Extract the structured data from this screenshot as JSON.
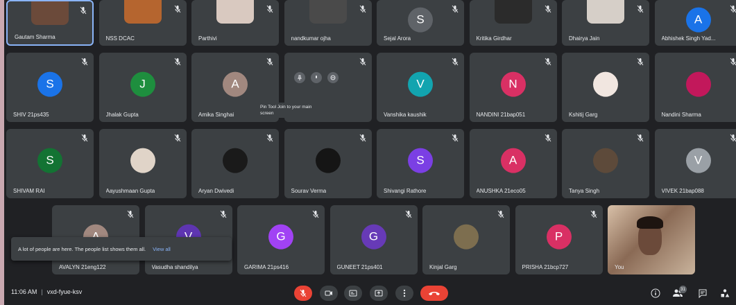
{
  "colors": {
    "tile_bg": "#3c4043",
    "page_bg": "#202124",
    "danger": "#ea4335",
    "link": "#8ab4f8"
  },
  "rows": [
    [
      {
        "name": "Gautam Sharma",
        "kind": "photo",
        "color": "#6b4a3a",
        "highlight": true
      },
      {
        "name": "NSS DCAC",
        "kind": "photo",
        "color": "#b5652f"
      },
      {
        "name": "Parthivi",
        "kind": "photo",
        "color": "#d9c9c0"
      },
      {
        "name": "nandkumar ojha",
        "kind": "photo",
        "color": "#4a4a4a"
      },
      {
        "name": "Sejal Arora",
        "kind": "letter",
        "letter": "S",
        "color": "#5f6368"
      },
      {
        "name": "Kritika Girdhar",
        "kind": "photo",
        "color": "#2b2b2b"
      },
      {
        "name": "Dhairya Jain",
        "kind": "photo",
        "color": "#d6cfc8"
      },
      {
        "name": "Abhishek Singh Yad...",
        "kind": "letter",
        "letter": "A",
        "color": "#1a73e8"
      }
    ],
    [
      {
        "name": "SHIV 21ps435",
        "kind": "letter",
        "letter": "S",
        "color": "#1a73e8"
      },
      {
        "name": "Jhalak Gupta",
        "kind": "letter",
        "letter": "J",
        "color": "#1e8e3e"
      },
      {
        "name": "Amika Singhai",
        "kind": "letter",
        "letter": "A",
        "color": "#a1887f"
      },
      {
        "name": "",
        "kind": "pinned"
      },
      {
        "name": "Vanshika kaushik",
        "kind": "letter",
        "letter": "V",
        "color": "#12a4af"
      },
      {
        "name": "NANDINI 21bap051",
        "kind": "letter",
        "letter": "N",
        "color": "#d93064"
      },
      {
        "name": "Kshitij Garg",
        "kind": "photo",
        "color": "#f1e6e0"
      },
      {
        "name": "Nandini Sharma",
        "kind": "photo",
        "color": "#c2185b"
      }
    ],
    [
      {
        "name": "SHIVAM RAI",
        "kind": "letter",
        "letter": "S",
        "color": "#137333"
      },
      {
        "name": "Aayushmaan Gupta",
        "kind": "photo",
        "color": "#e0d4c8"
      },
      {
        "name": "Aryan Dwivedi",
        "kind": "photo",
        "color": "#1a1a1a"
      },
      {
        "name": "Sourav Verma",
        "kind": "photo",
        "color": "#151515"
      },
      {
        "name": "Shivangi Rathore",
        "kind": "letter",
        "letter": "S",
        "color": "#7b3fe4"
      },
      {
        "name": "ANUSHKA 21eco05",
        "kind": "letter",
        "letter": "A",
        "color": "#d93064"
      },
      {
        "name": "Tanya Singh",
        "kind": "photo",
        "color": "#5d4a3a"
      },
      {
        "name": "VIVEK 21bap088",
        "kind": "letter",
        "letter": "V",
        "color": "#9aa0a6"
      }
    ],
    [
      {
        "name": "AVALYN 21eng122",
        "kind": "letter",
        "letter": "A",
        "color": "#a1887f"
      },
      {
        "name": "Vasudha shandilya",
        "kind": "letter",
        "letter": "V",
        "color": "#5e35b1"
      },
      {
        "name": "GARIMA 21ps416",
        "kind": "letter",
        "letter": "G",
        "color": "#a142f4"
      },
      {
        "name": "GUNEET 21ps401",
        "kind": "letter",
        "letter": "G",
        "color": "#673ab7"
      },
      {
        "name": "Kinjal Garg",
        "kind": "photo",
        "color": "#7d6e4f"
      },
      {
        "name": "PRISHA 21bcp727",
        "kind": "letter",
        "letter": "P",
        "color": "#d93064"
      },
      {
        "name": "You",
        "kind": "self"
      }
    ]
  ],
  "pinned_tooltip": "Pin Tool Join to your main screen",
  "toast": {
    "message": "A lot of people are here. The people list shows them all.",
    "link": "View all"
  },
  "meeting": {
    "time": "11:06 AM",
    "code": "vxd-fyue-ksv"
  },
  "controls": [
    "mic-off",
    "camera",
    "captions",
    "present",
    "more",
    "end-call"
  ],
  "right_controls": [
    {
      "icon": "info-icon"
    },
    {
      "icon": "people-icon",
      "badge": "31"
    },
    {
      "icon": "chat-icon"
    },
    {
      "icon": "activities-icon"
    }
  ]
}
